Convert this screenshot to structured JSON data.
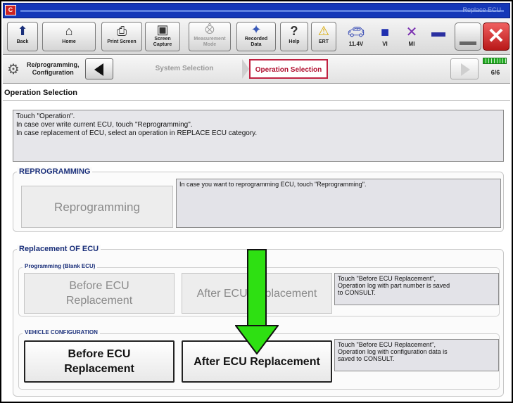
{
  "window": {
    "app_icon": "C",
    "title": "Replace ECU"
  },
  "toolbar": {
    "back": {
      "label": "Back",
      "icon": "back-arrow-icon"
    },
    "home": {
      "label": "Home",
      "icon": "home-icon"
    },
    "print_screen": {
      "label": "Print Screen",
      "icon": "printer-icon"
    },
    "screen_capture": {
      "label_line1": "Screen",
      "label_line2": "Capture",
      "icon": "camera-icon"
    },
    "measurement_mode": {
      "label_line1": "Measurement",
      "label_line2": "Mode",
      "icon": "gauge-icon"
    },
    "recorded_data": {
      "label_line1": "Recorded",
      "label_line2": "Data",
      "icon": "recorded-data-icon"
    },
    "help": {
      "label": "Help",
      "icon": "help-icon"
    },
    "ert": {
      "label": "ERT",
      "icon": "warning-icon"
    },
    "voltage": {
      "label": "11.4V",
      "icon": "car-icon"
    },
    "vi": {
      "label": "VI",
      "icon": "vi-icon"
    },
    "mi": {
      "label": "MI",
      "icon": "mi-icon"
    }
  },
  "nav": {
    "reprogramming_line1": "Re/programming,",
    "reprogramming_line2": "Configuration",
    "crumb_system": "System Selection",
    "crumb_operation": "Operation Selection",
    "progress_text": "6/6",
    "progress_fraction": 1.0
  },
  "page": {
    "title": "Operation Selection",
    "instructions": [
      "Touch \"Operation\".",
      "In case over write current ECU, touch \"Reprogramming\".",
      "In case replacement of ECU, select an operation in REPLACE ECU category."
    ]
  },
  "reprogramming": {
    "heading": "REPROGRAMMING",
    "button": "Reprogramming",
    "description": "In case you want to reprogramming ECU, touch \"Reprogramming\"."
  },
  "replacement": {
    "heading": "Replacement OF ECU",
    "blank": {
      "heading": "Programming (Blank ECU)",
      "before_line1": "Before ECU",
      "before_line2": "Replacement",
      "after": "After ECU Replacement",
      "description": [
        "Touch \"Before ECU Replacement\",",
        "Operation log with part number is saved",
        "to CONSULT."
      ]
    },
    "vehicle": {
      "heading": "VEHICLE CONFIGURATION",
      "before_line1": "Before ECU",
      "before_line2": "Replacement",
      "after": "After ECU Replacement",
      "description": [
        "Touch \"Before ECU Replacement\",",
        "Operation log with configuration data is",
        "saved to CONSULT."
      ]
    }
  },
  "colors": {
    "arrow": "#2ee012",
    "titlebar": "#1437b8",
    "active_crumb": "#b01030"
  }
}
